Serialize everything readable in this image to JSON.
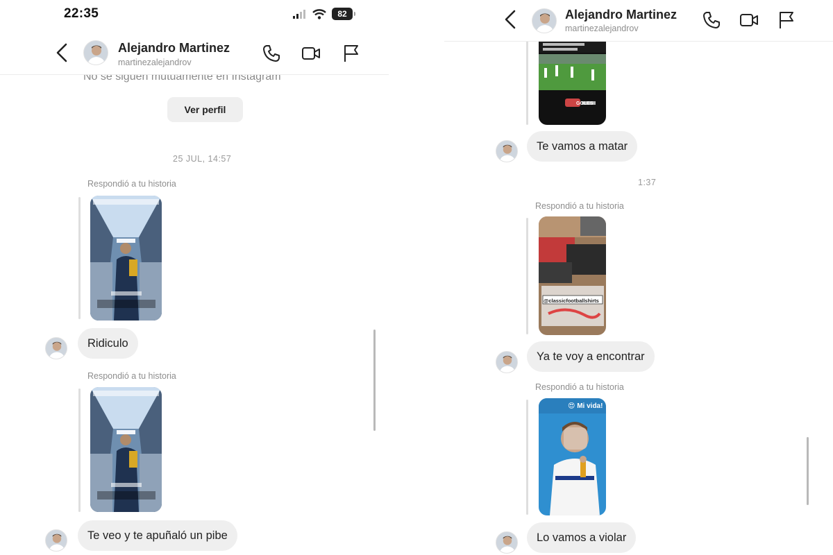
{
  "status_bar": {
    "time": "22:35",
    "battery": "82"
  },
  "contact": {
    "name": "Alejandro Martinez",
    "username": "martinezalejandrov"
  },
  "left": {
    "mutual_notice": "No se siguen mutuamente en Instagram",
    "view_profile_button": "Ver perfil",
    "timestamp": "25 JUL, 14:57",
    "messages": [
      {
        "replied_label": "Respondió a tu historia",
        "text": "Ridiculo"
      },
      {
        "replied_label": "Respondió a tu historia",
        "text": "Te veo y te apuñaló un pibe"
      }
    ]
  },
  "right": {
    "messages": [
      {
        "text": "Te vamos a matar"
      },
      {
        "replied_label": "Respondió a tu historia",
        "text": "Ya te voy a encontrar"
      },
      {
        "replied_label": "Respondió a tu historia",
        "text": "Lo vamos a violar"
      }
    ],
    "timestamp": "1:37",
    "story_captions": {
      "shirts_tag": "@classicfootballshirts",
      "mi_vida": "Mi vida!",
      "goles": "GOLES"
    }
  },
  "colors": {
    "bubble": "#efefef",
    "meta_text": "#8e8e8e",
    "story_blue": "#2f8fd0"
  },
  "icons": [
    "back-icon",
    "phone-icon",
    "video-call-icon",
    "flag-icon",
    "signal-icon",
    "wifi-icon",
    "battery-icon"
  ]
}
